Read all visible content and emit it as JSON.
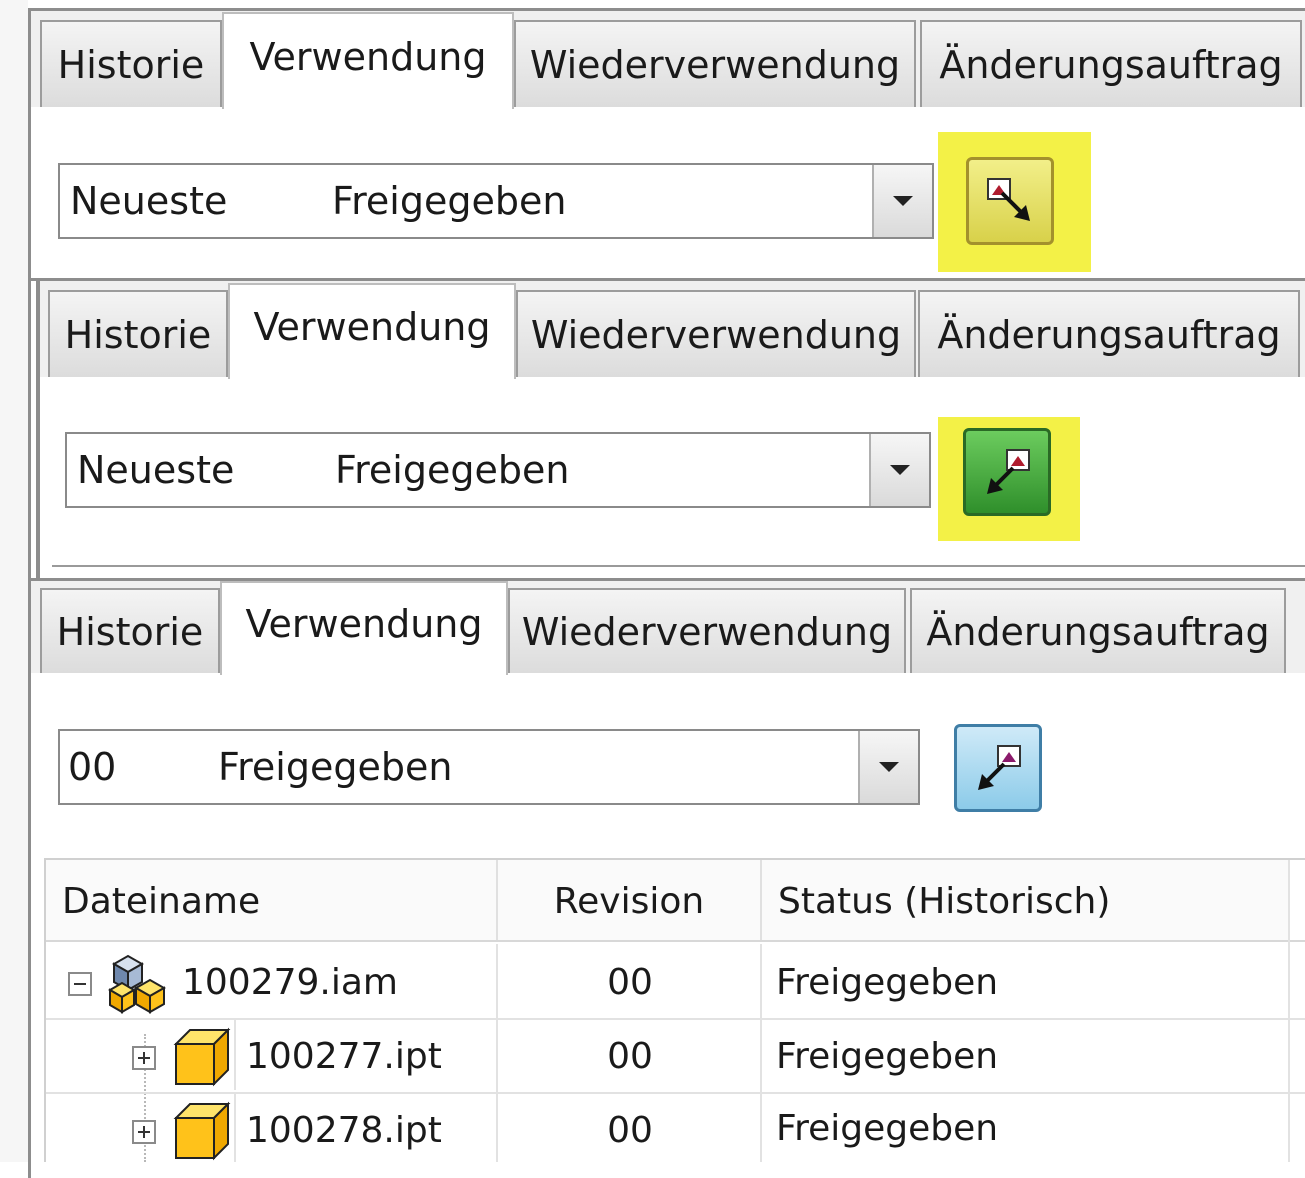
{
  "colors": {
    "highlight": "#f3f147",
    "button_yellow": "#e7e35a",
    "button_green": "#3fa83a",
    "button_blue": "#9fd3ee"
  },
  "panel1": {
    "tabs": [
      "Historie",
      "Verwendung",
      "Wiederverwendung",
      "Änderungsauftrag"
    ],
    "active_tab": "Verwendung",
    "combo": {
      "version": "Neueste",
      "state": "Freigegeben"
    },
    "button_icon": "arrow-down-right-icon"
  },
  "panel2": {
    "tabs": [
      "Historie",
      "Verwendung",
      "Wiederverwendung",
      "Änderungsauftrag"
    ],
    "active_tab": "Verwendung",
    "combo": {
      "version": "Neueste",
      "state": "Freigegeben"
    },
    "button_icon": "arrow-up-left-icon"
  },
  "panel3": {
    "tabs": [
      "Historie",
      "Verwendung",
      "Wiederverwendung",
      "Änderungsauftrag"
    ],
    "active_tab": "Verwendung",
    "combo": {
      "version": "00",
      "state": "Freigegeben"
    },
    "button_icon": "arrow-up-left-icon",
    "table": {
      "columns": [
        "Dateiname",
        "Revision",
        "Status (Historisch)"
      ],
      "rows": [
        {
          "name": "100279.iam",
          "revision": "00",
          "status": "Freigegeben",
          "icon": "assembly-icon",
          "expander": "collapse-icon"
        },
        {
          "name": "100277.ipt",
          "revision": "00",
          "status": "Freigegeben",
          "icon": "part-icon",
          "expander": "expand-icon"
        },
        {
          "name": "100278.ipt",
          "revision": "00",
          "status": "Freigegeben",
          "icon": "part-icon",
          "expander": "expand-icon"
        }
      ]
    }
  }
}
